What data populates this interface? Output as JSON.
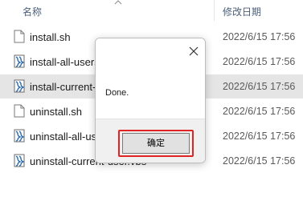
{
  "header": {
    "col_name": "名称",
    "col_date": "修改日期"
  },
  "files": [
    {
      "name": "install.sh",
      "date": "2022/6/15 17:56",
      "icon": "file-icon"
    },
    {
      "name": "install-all-users.vbs",
      "date": "2022/6/15 17:56",
      "icon": "script-icon"
    },
    {
      "name": "install-current-user.vbs",
      "date": "2022/6/15 17:56",
      "icon": "script-icon",
      "selected": true
    },
    {
      "name": "uninstall.sh",
      "date": "2022/6/15 17:56",
      "icon": "file-icon"
    },
    {
      "name": "uninstall-all-users.vbs",
      "date": "2022/6/15 17:56",
      "icon": "script-icon"
    },
    {
      "name": "uninstall-current-user.vbs",
      "date": "2022/6/15 17:56",
      "icon": "script-icon"
    }
  ],
  "dialog": {
    "message": "Done.",
    "ok_label": "确定",
    "close_icon": "close-icon",
    "highlight_color": "#e02424"
  }
}
